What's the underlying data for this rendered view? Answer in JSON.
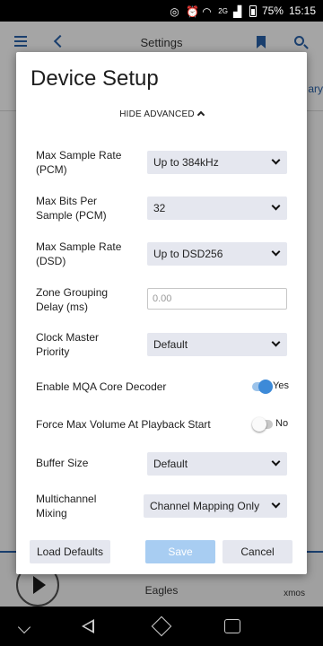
{
  "status_bar": {
    "battery": "75%",
    "time": "15:15",
    "network": "2G"
  },
  "app": {
    "header_title": "Settings",
    "subbar_right_text": "ary",
    "player_artist": "Eagles",
    "player_zone": "xmos"
  },
  "modal": {
    "title": "Device Setup",
    "toggle_advanced": "HIDE ADVANCED",
    "rows": {
      "max_sample_rate_pcm": {
        "label": "Max Sample Rate (PCM)",
        "value": "Up to 384kHz"
      },
      "max_bits_per_sample": {
        "label": "Max Bits Per Sample (PCM)",
        "value": "32"
      },
      "max_sample_rate_dsd": {
        "label": "Max Sample Rate (DSD)",
        "value": "Up to DSD256"
      },
      "zone_grouping_delay": {
        "label": "Zone Grouping Delay (ms)",
        "placeholder": "0.00"
      },
      "clock_master_priority": {
        "label": "Clock Master Priority",
        "value": "Default"
      },
      "enable_mqa": {
        "label": "Enable MQA Core Decoder",
        "state": "Yes"
      },
      "force_max_volume": {
        "label": "Force Max Volume At Playback Start",
        "state": "No"
      },
      "buffer_size": {
        "label": "Buffer Size",
        "value": "Default"
      },
      "multichannel_mixing": {
        "label": "Multichannel Mixing",
        "value": "Channel Mapping Only"
      }
    },
    "buttons": {
      "load_defaults": "Load Defaults",
      "save": "Save",
      "cancel": "Cancel"
    }
  },
  "colors": {
    "accent": "#3d8ad8",
    "save_disabled": "#a8cdf2",
    "field_bg": "#e5e7ef",
    "nav_blue": "#1a3f6e"
  }
}
